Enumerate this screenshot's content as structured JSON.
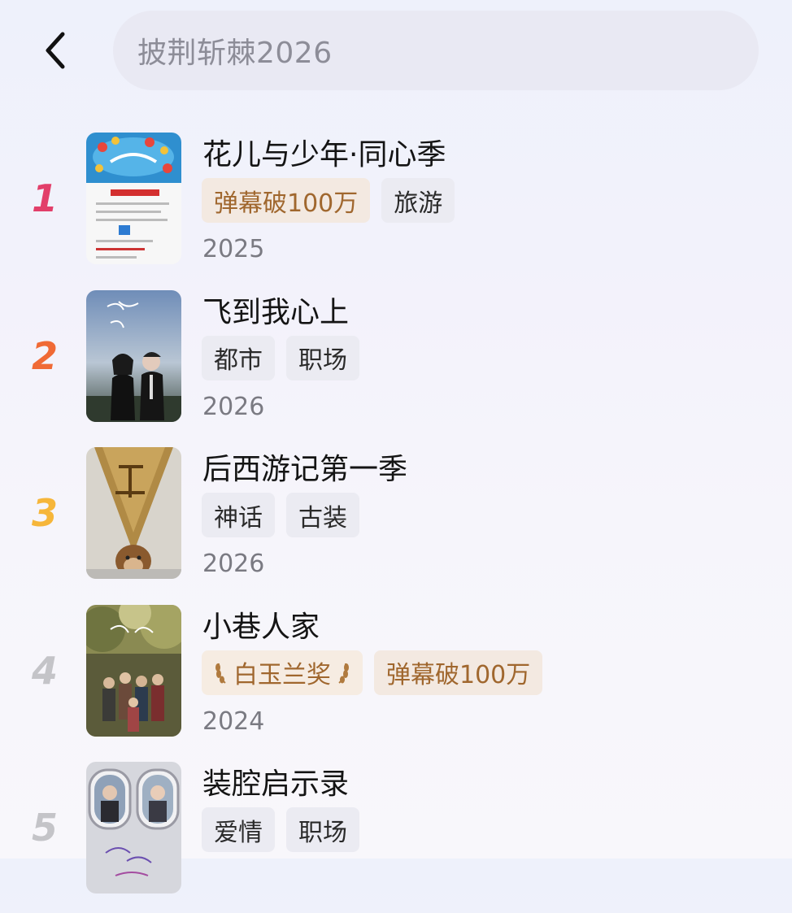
{
  "search": {
    "query": "披荆斩棘2026"
  },
  "icons": {
    "back": "chevron-left-icon",
    "award_leaf": "laurel-icon"
  },
  "colors": {
    "rank1": "#e23f6a",
    "rank2": "#f06a35",
    "rank3": "#f6b63a",
    "rank_other": "#c4c4c8",
    "highlight_tag_text": "#a0672e",
    "highlight_tag_bg": "#f3e9e1"
  },
  "items": [
    {
      "rank": "1",
      "title": "花儿与少年·同心季",
      "tags": [
        "弹幕破100万",
        "旅游"
      ],
      "year": "2025"
    },
    {
      "rank": "2",
      "title": "飞到我心上",
      "tags": [
        "都市",
        "职场"
      ],
      "year": "2026"
    },
    {
      "rank": "3",
      "title": "后西游记第一季",
      "tags": [
        "神话",
        "古装"
      ],
      "year": "2026"
    },
    {
      "rank": "4",
      "title": "小巷人家",
      "tags": [
        "白玉兰奖",
        "弹幕破100万"
      ],
      "year": "2024"
    },
    {
      "rank": "5",
      "title": "装腔启示录",
      "tags": [
        "爱情",
        "职场"
      ],
      "year": ""
    }
  ]
}
